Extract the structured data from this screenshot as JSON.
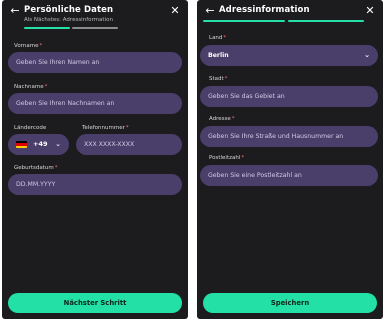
{
  "left_screen": {
    "title": "Persönliche Daten",
    "subtitle": "Als Nächstes: Adressinformation",
    "back_icon": "arrow-left-icon",
    "close_icon": "close-icon",
    "progress_steps": [
      "active",
      "inactive"
    ],
    "fields": {
      "vorname": {
        "label": "Vorname",
        "required": "*",
        "placeholder": "Geben Sie Ihren Namen an"
      },
      "nachname": {
        "label": "Nachname",
        "required": "*",
        "placeholder": "Geben Sie Ihren Nachnamen an"
      },
      "laendercode": {
        "label": "Ländercode",
        "value": "+49",
        "flag": "germany-flag-icon"
      },
      "telefonnummer": {
        "label": "Telefonnummer",
        "required": "*",
        "placeholder": "XXX XXXX-XXXX"
      },
      "geburtsdatum": {
        "label": "Geburtsdatum",
        "required": "*",
        "placeholder": "DD.MM.YYYY"
      }
    },
    "button_label": "Nächster Schritt"
  },
  "right_screen": {
    "title": "Adressinformation",
    "back_icon": "arrow-left-icon",
    "close_icon": "close-icon",
    "progress_steps": [
      "active",
      "active"
    ],
    "fields": {
      "land": {
        "label": "Land",
        "required": "*",
        "value": "Berlin"
      },
      "stadt": {
        "label": "Stadt",
        "required": "*",
        "placeholder": "Geben Sie das Gebiet an"
      },
      "adresse": {
        "label": "Adresse",
        "required": "*",
        "placeholder": "Geben Sie Ihre Straße und Hausnummer an"
      },
      "postleitzahl": {
        "label": "Postleitzahl",
        "required": "*",
        "placeholder": "Geben Sie eine Postleitzahl an"
      }
    },
    "button_label": "Speichern"
  },
  "colors": {
    "background": "#1c1c1e",
    "field": "#4a3f6b",
    "accent": "#22e0a6",
    "required": "#ff6b6b"
  }
}
